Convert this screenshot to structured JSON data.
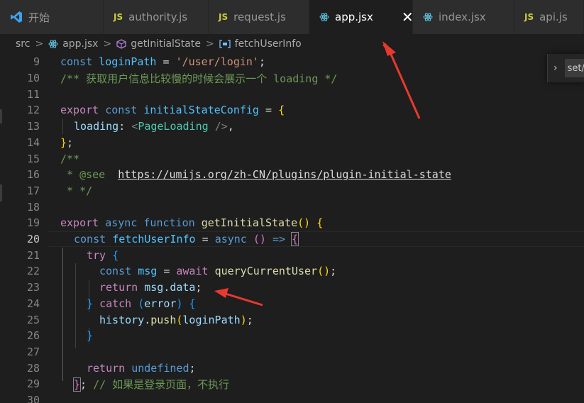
{
  "tabs": [
    {
      "label": "开始",
      "icon": "vscode-logo-icon",
      "active": false
    },
    {
      "label": "authority.js",
      "icon": "js-file-icon",
      "badge": "JS",
      "active": false
    },
    {
      "label": "request.js",
      "icon": "js-file-icon",
      "badge": "JS",
      "active": false
    },
    {
      "label": "app.jsx",
      "icon": "react-file-icon",
      "active": true,
      "close": "✕"
    },
    {
      "label": "index.jsx",
      "icon": "react-file-icon",
      "active": false
    },
    {
      "label": "api.js",
      "icon": "js-file-icon",
      "badge": "JS",
      "active": false
    }
  ],
  "breadcrumb": {
    "items": [
      "src",
      "app.jsx",
      "getInitialState",
      "fetchUserInfo"
    ],
    "separator": ">"
  },
  "find_widget": {
    "value": "set/"
  },
  "editor": {
    "current_line": 20,
    "lines": [
      {
        "n": "9"
      },
      {
        "n": "10"
      },
      {
        "n": "11"
      },
      {
        "n": "12"
      },
      {
        "n": "13"
      },
      {
        "n": "14"
      },
      {
        "n": "15"
      },
      {
        "n": "16"
      },
      {
        "n": "17"
      },
      {
        "n": "18"
      },
      {
        "n": "19"
      },
      {
        "n": "20"
      },
      {
        "n": "21"
      },
      {
        "n": "22"
      },
      {
        "n": "23"
      },
      {
        "n": "24"
      },
      {
        "n": "25"
      },
      {
        "n": "26"
      },
      {
        "n": "27"
      },
      {
        "n": "28"
      },
      {
        "n": "29"
      },
      {
        "n": "30"
      }
    ],
    "code": {
      "l9": [
        "const",
        "loginPath",
        "=",
        "'/user/login'",
        ";"
      ],
      "l10": "/** 获取用户信息比较慢的时候会展示一个 loading */",
      "l12": [
        "export",
        "const",
        "initialStateConfig",
        "=",
        "{"
      ],
      "l13": [
        "loading",
        ":",
        "<",
        "PageLoading",
        "/>",
        ","
      ],
      "l14": [
        "}",
        ";"
      ],
      "l15": "/**",
      "l16": [
        " * @see  ",
        "https://umijs.org/zh-CN/plugins/plugin-initial-state"
      ],
      "l17": " * */",
      "l19": [
        "export",
        "async",
        "function",
        "getInitialState",
        "()",
        "{"
      ],
      "l20": [
        "const",
        "fetchUserInfo",
        "=",
        "async",
        "()",
        "=>",
        "{"
      ],
      "l21": [
        "try",
        "{"
      ],
      "l22": [
        "const",
        "msg",
        "=",
        "await",
        "queryCurrentUser",
        "()",
        ";"
      ],
      "l23": [
        "return",
        "msg",
        ".",
        "data",
        ";"
      ],
      "l24": [
        "}",
        "catch",
        "(",
        "error",
        ")",
        "{"
      ],
      "l25": [
        "history",
        ".",
        "push",
        "(",
        "loginPath",
        ")",
        ";"
      ],
      "l26": [
        "}"
      ],
      "l28": [
        "return",
        "undefined",
        ";"
      ],
      "l29": [
        "}",
        ";",
        "// 如果是登录页面，不执行"
      ]
    }
  },
  "colors": {
    "background": "#1e1e1e",
    "keyword": "#569cd6",
    "control": "#c586c0",
    "variable": "#9cdcfe",
    "function": "#dcdcaa",
    "string": "#ce9178",
    "comment": "#6a9955",
    "annotation_arrow": "#e8392f"
  }
}
